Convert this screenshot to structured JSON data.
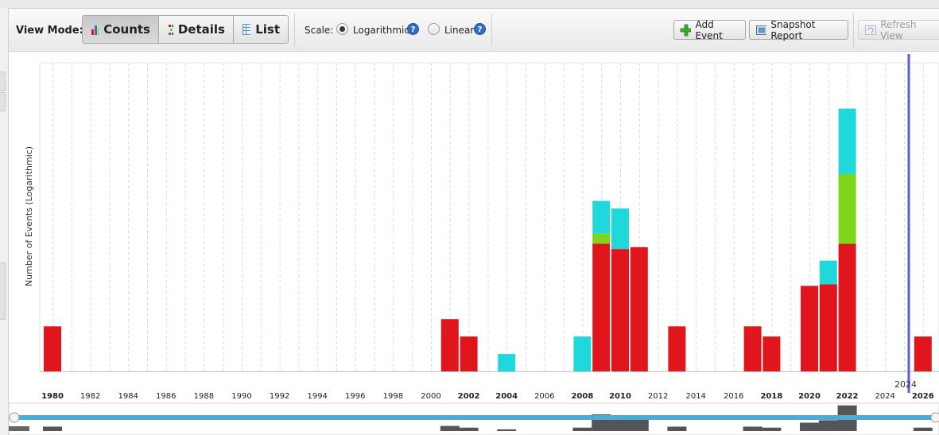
{
  "toolbar": {
    "view_mode_label": "View Mode:",
    "view_modes": [
      {
        "label": "Counts",
        "icon": "bar-chart-icon",
        "selected": true
      },
      {
        "label": "Details",
        "icon": "details-icon",
        "selected": false
      },
      {
        "label": "List",
        "icon": "list-icon",
        "selected": false
      }
    ],
    "scale_label": "Scale:",
    "scale_options": [
      {
        "label": "Logarithmic",
        "selected": true
      },
      {
        "label": "Linear",
        "selected": false
      }
    ],
    "add_event_label": "Add Event",
    "snapshot_report_label": "Snapshot Report",
    "refresh_view_label": "Refresh View"
  },
  "chart_data": {
    "type": "bar",
    "stacked": true,
    "log_scale": true,
    "ylabel": "Number of Events (Logarithmic)",
    "x_ticks": [
      "1980",
      "1982",
      "1984",
      "1986",
      "1988",
      "1990",
      "1992",
      "1994",
      "1996",
      "1998",
      "2000",
      "2002",
      "2004",
      "2006",
      "2008",
      "2010",
      "2012",
      "2014",
      "2016",
      "2018",
      "2020",
      "2022",
      "2024",
      "2026"
    ],
    "bold_ticks": [
      "1980",
      "2002",
      "2004",
      "2008",
      "2010",
      "2018",
      "2020",
      "2022",
      "2026"
    ],
    "current_marker_label": "2024",
    "series_colors": [
      "#e0161c",
      "#7ed61a",
      "#1ed8dc"
    ],
    "series": [
      {
        "name": "",
        "color": "#e0161c",
        "points": [
          [
            1980,
            3
          ],
          [
            2001,
            4
          ],
          [
            2002,
            2
          ],
          [
            2009,
            80
          ],
          [
            2010,
            65
          ],
          [
            2011,
            70
          ],
          [
            2013,
            3
          ],
          [
            2017,
            3
          ],
          [
            2018,
            2
          ],
          [
            2020,
            15
          ],
          [
            2021,
            16
          ],
          [
            2022,
            80
          ],
          [
            2026,
            2
          ]
        ]
      },
      {
        "name": "",
        "color": "#7ed61a",
        "points": [
          [
            2009,
            40
          ],
          [
            2022,
            1200
          ]
        ]
      },
      {
        "name": "",
        "color": "#1ed8dc",
        "points": [
          [
            2004,
            1
          ],
          [
            2008,
            2
          ],
          [
            2009,
            320
          ],
          [
            2010,
            260
          ],
          [
            2021,
            25
          ],
          [
            2022,
            16000
          ]
        ]
      }
    ],
    "grid": true
  }
}
